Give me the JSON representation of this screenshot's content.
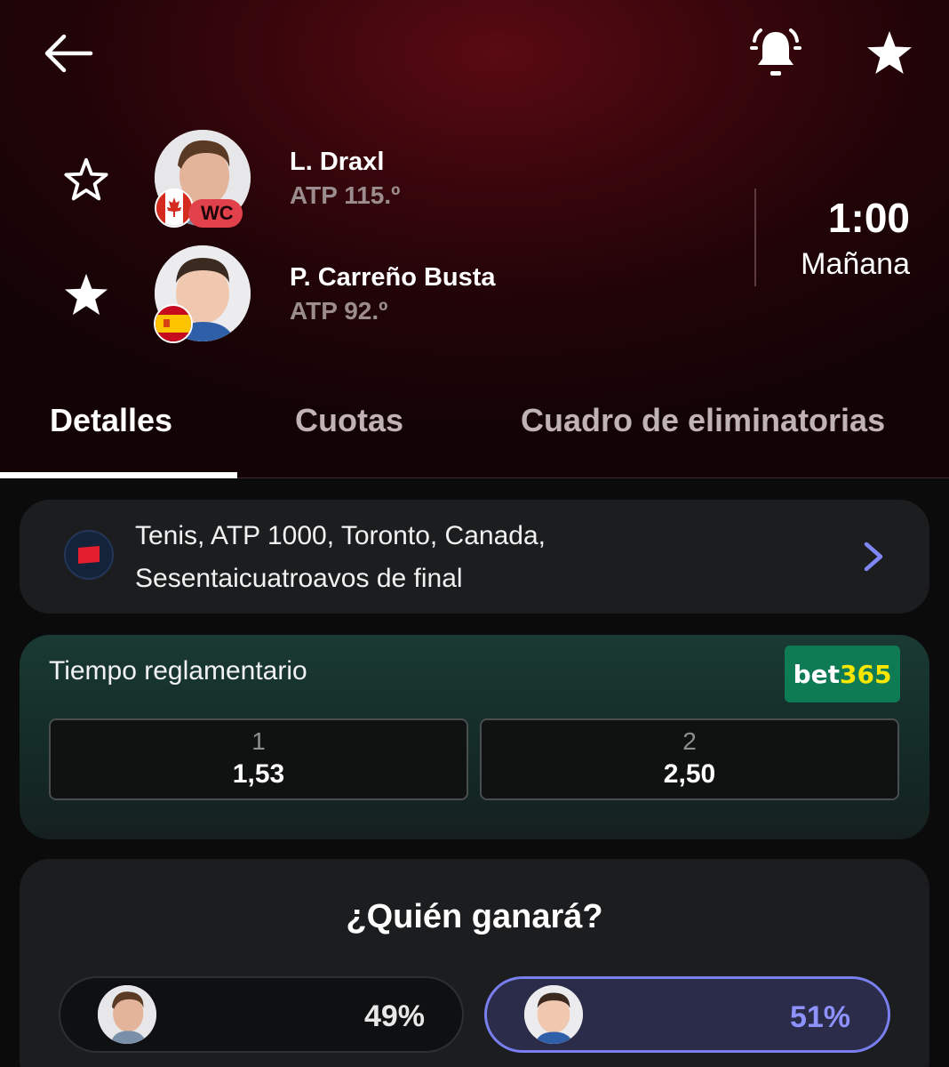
{
  "colors": {
    "accent_red": "#e0414b",
    "vote_selected": "#8e92ff",
    "bet365_green": "#0f7b55",
    "bet365_yellow": "#f7e600"
  },
  "header": {
    "icons": [
      "arrow-left-icon",
      "bell-ringing-icon",
      "star-filled-icon"
    ]
  },
  "players": [
    {
      "name": "L. Draxl",
      "rank": "ATP 115.º",
      "badge": "WC",
      "flag": "canada-flag-icon",
      "favorite": false
    },
    {
      "name": "P. Carreño Busta",
      "rank": "ATP 92.º",
      "flag": "spain-flag-icon",
      "favorite": true
    }
  ],
  "match": {
    "time": "1:00",
    "day": "Mañana"
  },
  "tabs": [
    {
      "label": "Detalles",
      "active": true
    },
    {
      "label": "Cuotas",
      "active": false
    },
    {
      "label": "Cuadro de eliminatorias",
      "active": false
    }
  ],
  "tournament": {
    "line1": "Tenis, ATP 1000, Toronto, Canada,",
    "line2": "Sesentaicuatroavos de final",
    "logo": "tournament-logo-icon"
  },
  "odds": {
    "title": "Tiempo reglamentario",
    "bookmaker_a": "bet",
    "bookmaker_b": "365",
    "options": [
      {
        "label": "1",
        "value": "1,53"
      },
      {
        "label": "2",
        "value": "2,50"
      }
    ]
  },
  "vote": {
    "title": "¿Quién ganará?",
    "options": [
      {
        "percent": "49%",
        "selected": false
      },
      {
        "percent": "51%",
        "selected": true
      }
    ]
  }
}
